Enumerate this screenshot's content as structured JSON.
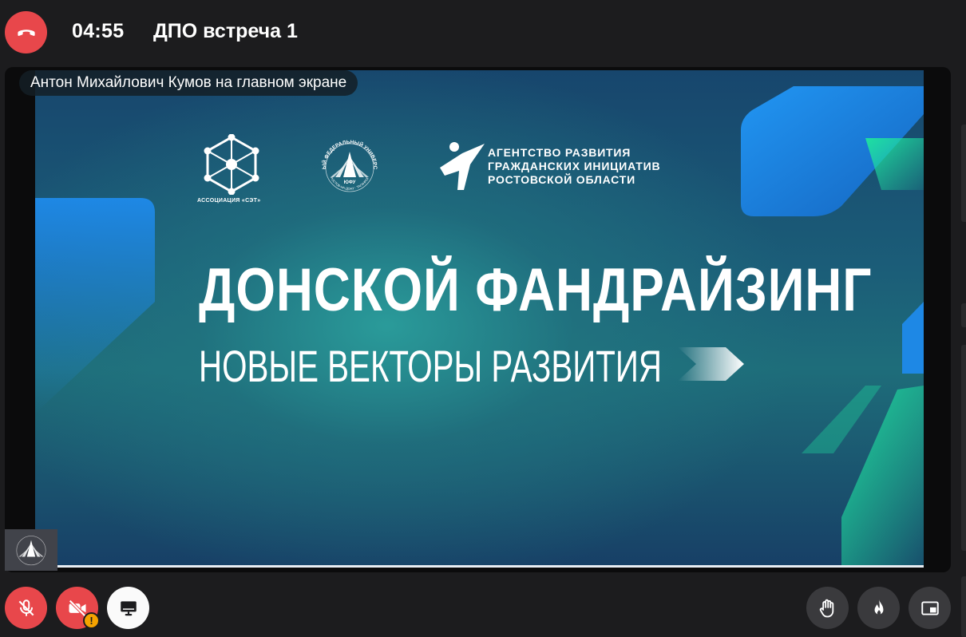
{
  "call": {
    "timer": "04:55",
    "title": "ДПО встреча 1"
  },
  "stage": {
    "presenter_label": "Антон Михайлович Кумов на главном экране"
  },
  "slide": {
    "title": "ДОНСКОЙ ФАНДРАЙЗИНГ",
    "subtitle": "НОВЫЕ ВЕКТОРЫ РАЗВИТИЯ",
    "logo_association_caption": "АССОЦИАЦИЯ «СЭТ»",
    "logo_university_text": "ЮЖНЫЙ ФЕДЕРАЛЬНЫЙ УНИВЕРСИТЕТ",
    "logo_university_abbr": "ЮФУ",
    "logo_university_city": "РОСТОВ-НА-ДОНУ · ТАГАНРОГ",
    "agency_line_1": "АГЕНТСТВО РАЗВИТИЯ",
    "agency_line_2": "ГРАЖДАНСКИХ ИНИЦИАТИВ",
    "agency_line_3": "РОСТОВСКОЙ ОБЛАСТИ"
  },
  "controls": {
    "end_call_icon": "phone-hangup-icon",
    "mic_icon": "mic-off-icon",
    "camera_icon": "camera-off-icon",
    "camera_warning_icon": "warning-icon",
    "camera_warning_text": "!",
    "screen_share_icon": "monitor-icon",
    "raise_hand_icon": "hand-icon",
    "reactions_icon": "fire-icon",
    "pip_icon": "picture-in-picture-icon"
  },
  "colors": {
    "accent_red": "#e8474b",
    "warning": "#f5a300",
    "background": "#1c1c1e",
    "slide_blue": "#1e88e5",
    "slide_green": "#19d39a"
  }
}
